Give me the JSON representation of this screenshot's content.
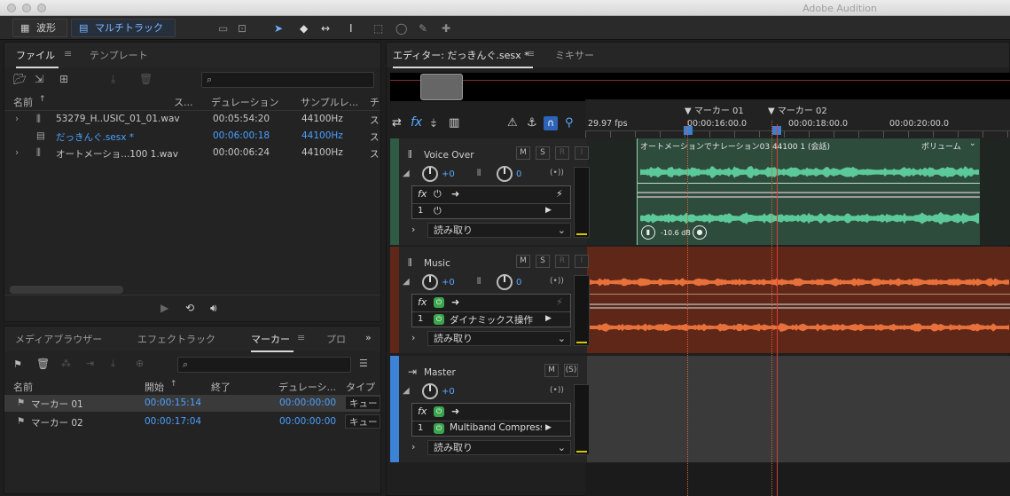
{
  "window": {
    "title": "Adobe Audition"
  },
  "toolbar": {
    "waveform_label": "波形",
    "multitrack_label": "マルチトラック"
  },
  "files_panel": {
    "tabs": [
      {
        "label": "ファイル"
      },
      {
        "label": "テンプレート"
      }
    ],
    "columns": {
      "name": "名前",
      "status": "ス...",
      "duration": "デュレーション",
      "samplerate": "サンプルレ...",
      "ch": "チ"
    },
    "rows": [
      {
        "name": "53279_H..USIC_01_01.wav",
        "duration": "00:05:54:20",
        "rate": "44100Hz",
        "ch": "ス"
      },
      {
        "name": "だっきんぐ.sesx *",
        "duration": "00:06:00:18",
        "rate": "44100Hz",
        "ch": "ス"
      },
      {
        "name": "オートメーショ...100 1.wav",
        "duration": "00:00:06:24",
        "rate": "44100Hz",
        "ch": "ス"
      }
    ]
  },
  "markers_panel": {
    "tabs": [
      {
        "label": "メディアブラウザー"
      },
      {
        "label": "エフェクトラック"
      },
      {
        "label": "マーカー"
      },
      {
        "label": "プロ"
      }
    ],
    "columns": {
      "name": "名前",
      "start": "開始",
      "end": "終了",
      "duration": "デュレーシ...",
      "type": "タイプ"
    },
    "rows": [
      {
        "name": "マーカー 01",
        "start": "00:00:15:14",
        "duration": "00:00:00:00",
        "type": "キュー"
      },
      {
        "name": "マーカー 02",
        "start": "00:00:17:04",
        "duration": "00:00:00:00",
        "type": "キュー"
      }
    ]
  },
  "editor": {
    "tab_label": "エディター: だっきんぐ.sesx *",
    "mixer_label": "ミキサー",
    "fps": "29.97 fps",
    "timecodes": [
      "00:00:16:00.0",
      "00:00:18:00.0",
      "00:00:20:00.0"
    ],
    "markers": [
      "マーカー 01",
      "マーカー 02"
    ],
    "clip_title": "オートメーションでナレーション03 44100 1 (会話)",
    "clip_param": "ボリューム",
    "clip_gain": "-10.6 dB"
  },
  "tracks": [
    {
      "name": "Voice Over",
      "vol": "+0",
      "pan": "0",
      "slot_label": "",
      "read": "読み取り",
      "color": "#2b3a30",
      "wave": "#5cc99a",
      "fx_on": false
    },
    {
      "name": "Music",
      "vol": "+0",
      "pan": "0",
      "slot_label": "ダイナミックス操作",
      "read": "読み取り",
      "color": "#5a2a1a",
      "wave": "#e8703a",
      "fx_on": true
    },
    {
      "name": "Master",
      "vol": "+0",
      "pan": "",
      "slot_label": "Multiband Compressor",
      "read": "読み取り",
      "color": "#3a3a3a",
      "wave": "",
      "fx_on": true
    }
  ],
  "colors": {
    "accent": "#4aa0ff",
    "track_green": "#2f5b45",
    "track_orange": "#5e2718",
    "playhead": "#e03a3a"
  }
}
